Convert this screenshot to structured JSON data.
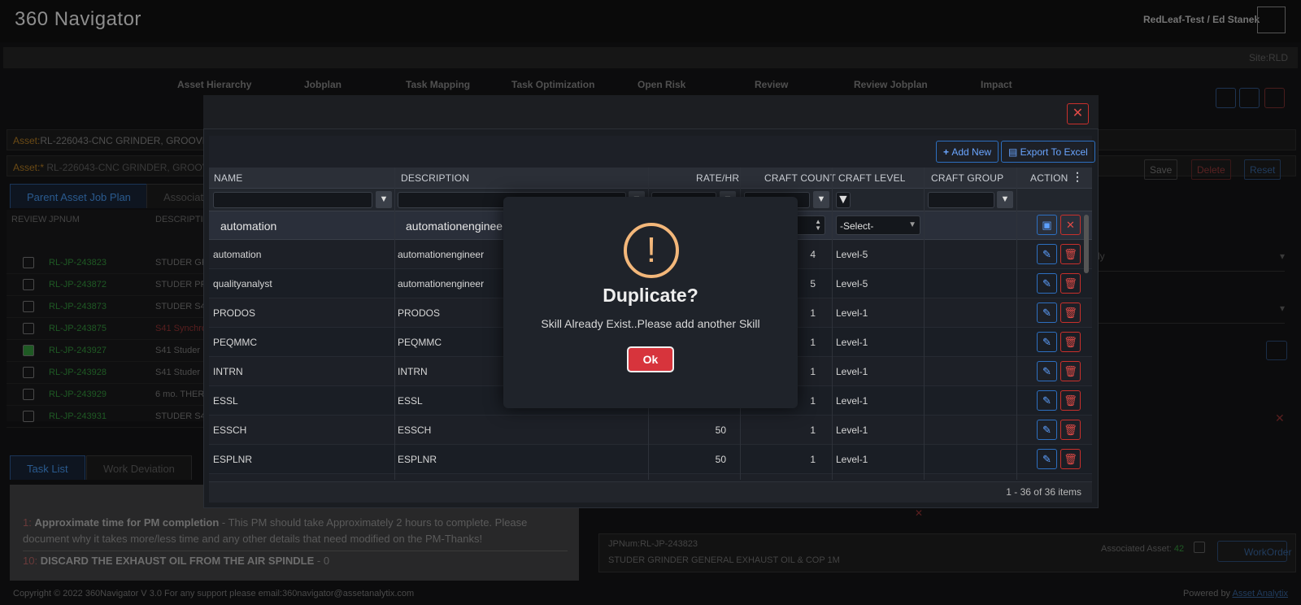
{
  "app": {
    "logo": "360 Navigator",
    "user": "RedLeaf-Test / Ed Stanek",
    "site": "Site:RLD"
  },
  "nav": [
    "Asset Hierarchy",
    "Jobplan",
    "Task Mapping",
    "Task Optimization",
    "Open Risk",
    "Review",
    "Review Jobplan",
    "Impact"
  ],
  "asset": {
    "label1": "Asset:",
    "value1": "RL-226043-CNC GRINDER, GROOVE",
    "label2": "Asset:*",
    "value2": "RL-226043-CNC GRINDER, GROOVE"
  },
  "actions": {
    "save": "Save",
    "delete": "Delete",
    "reset": "Reset"
  },
  "left_tabs": [
    "Parent Asset Job Plan",
    "Associat"
  ],
  "left_grid": {
    "headers": [
      "REVIEW",
      "JPNUM",
      "DESCRIPTI"
    ],
    "rows": [
      {
        "jp": "RL-JP-243823",
        "desc": "STUDER GR"
      },
      {
        "jp": "RL-JP-243872",
        "desc": "STUDER PR"
      },
      {
        "jp": "RL-JP-243873",
        "desc": "STUDER S4"
      },
      {
        "jp": "RL-JP-243875",
        "desc": "S41 Synchro"
      },
      {
        "jp": "RL-JP-243927",
        "desc": "S41 Studer"
      },
      {
        "jp": "RL-JP-243928",
        "desc": "S41 Studer"
      },
      {
        "jp": "RL-JP-243929",
        "desc": "6 mo. THER"
      },
      {
        "jp": "RL-JP-243931",
        "desc": "STUDER S4"
      }
    ]
  },
  "task_tabs": [
    "Task List",
    "Work Deviation"
  ],
  "tasks": {
    "t1_num": "1:",
    "t1_title": "Approximate time for PM completion",
    "t1_body": " - This PM should take Approximately 2 hours to complete.  Please document why it takes more/less time and any other details that need modified on the PM-Thanks!",
    "t2_num": "10:",
    "t2_title": "DISCARD THE EXHAUST OIL FROM THE AIR SPINDLE",
    "t2_body": " - 0"
  },
  "right_info": {
    "jpnum": "JPNum:RL-JP-243823",
    "desc": "STUDER GRINDER GENERAL EXHAUST OIL & COP 1M",
    "assoc_label": "Associated Asset:",
    "assoc_count": "42",
    "workorder": "WorkOrder",
    "dropdown_tail": "ly"
  },
  "footer": {
    "copyright": "Copyright © 2022 360Navigator V 3.0    For any support please email:360navigator@assetanalytix.com",
    "powered": "Powered by",
    "powered_link": "Asset Analytix"
  },
  "modal": {
    "add_new": "Add New",
    "export": "Export To Excel",
    "columns": [
      "NAME",
      "DESCRIPTION",
      "RATE/HR",
      "CRAFT COUNT",
      "CRAFT LEVEL",
      "CRAFT GROUP",
      "ACTION"
    ],
    "edit_row": {
      "name": "automation",
      "description": "automationengineer",
      "level_placeholder": "-Select-"
    },
    "rows": [
      {
        "name": "automation",
        "description": "automationengineer",
        "rate": "",
        "count": "4",
        "level": "Level-5"
      },
      {
        "name": "qualityanalyst",
        "description": "automationengineer",
        "rate": "",
        "count": "5",
        "level": "Level-5"
      },
      {
        "name": "PRODOS",
        "description": "PRODOS",
        "rate": "",
        "count": "1",
        "level": "Level-1"
      },
      {
        "name": "PEQMMC",
        "description": "PEQMMC",
        "rate": "",
        "count": "1",
        "level": "Level-1"
      },
      {
        "name": "INTRN",
        "description": "INTRN",
        "rate": "",
        "count": "1",
        "level": "Level-1"
      },
      {
        "name": "ESSL",
        "description": "ESSL",
        "rate": "",
        "count": "1",
        "level": "Level-1"
      },
      {
        "name": "ESSCH",
        "description": "ESSCH",
        "rate": "50",
        "count": "1",
        "level": "Level-1"
      },
      {
        "name": "ESPLNR",
        "description": "ESPLNR",
        "rate": "50",
        "count": "1",
        "level": "Level-1"
      }
    ],
    "pager": "1 - 36 of 36 items"
  },
  "alert": {
    "title": "Duplicate?",
    "message": "Skill Already Exist..Please add another Skill",
    "ok": "Ok"
  },
  "colors": {
    "accent": "#2d6fc0",
    "danger": "#d7343c",
    "warning": "#f3b77a"
  }
}
